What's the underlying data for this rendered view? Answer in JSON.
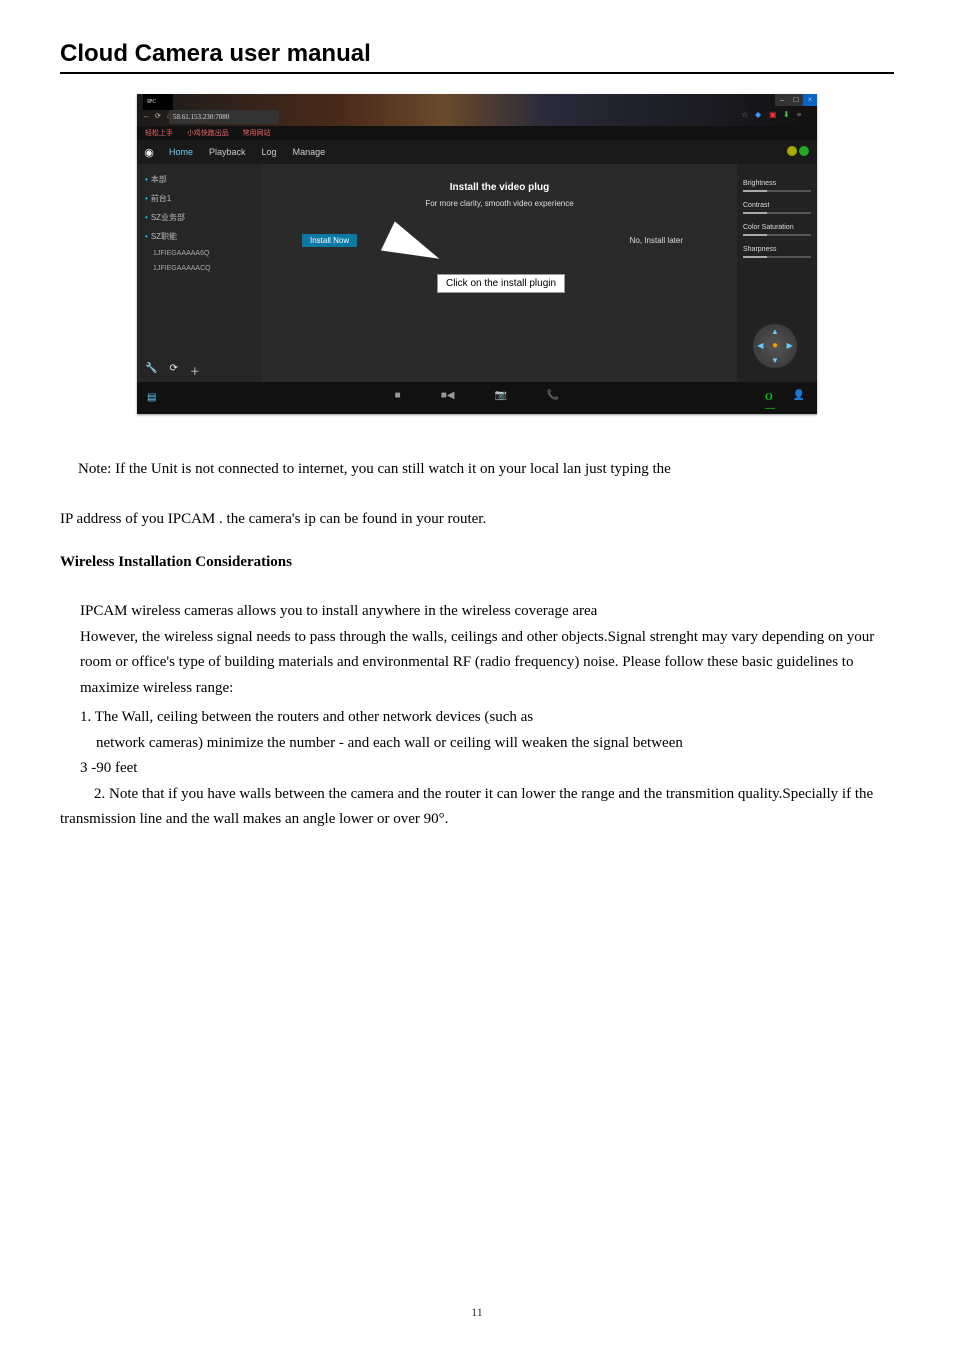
{
  "doc_title": "Cloud Camera user manual",
  "page_number": "11",
  "browser": {
    "tab_title": "IPC",
    "url": "58.61.153.230:7080",
    "bookmarks": [
      "轻松上手",
      "小鸡快跑出品",
      "常用网站"
    ]
  },
  "app": {
    "topnav": {
      "home": "Home",
      "playback": "Playback",
      "log": "Log",
      "manage": "Manage"
    },
    "sidebar": {
      "items": [
        "本部",
        "前台1",
        "SZ业务部",
        "SZ职能"
      ],
      "subitems": [
        "1JFIEGAAAAA6Q",
        "1JFIEGAAAAACQ"
      ]
    },
    "center": {
      "title": "Install the video plug",
      "subtitle": "For more clarity, smooth video experience",
      "install_btn": "Install Now",
      "later_btn": "No, Install later",
      "callout": "Click on the install plugin"
    },
    "right": {
      "brightness": "Brightness",
      "contrast": "Contrast",
      "saturation": "Color Saturation",
      "sharpness": "Sharpness"
    },
    "record_label": "O—"
  },
  "note_text": "Note: If the Unit is not connected to internet, you can still watch it on your local lan just typing the",
  "note_text2": "IP address of you IPCAM . the camera's ip can be found in your router.",
  "section_title": "Wireless Installation Considerations",
  "para1": "IPCAM wireless cameras allows you to install anywhere in the wireless coverage area",
  "para2": "However, the wireless signal needs to pass through the walls, ceilings and other objects.Signal strenght may vary depending on your room or office's type of building materials and environmental RF (radio frequency) noise. Please follow these basic guidelines to maximize wireless range:",
  "li1": "1. The Wall, ceiling between the routers and other network devices (such as",
  "li1b": "network cameras) minimize the number - and each wall or ceiling will weaken the signal between",
  "li1c": "3 -90 feet",
  "li2": "2.  Note that if you have walls between the camera and the router it can lower the range and the transmition quality.Specially if the transmission line and the wall makes an angle lower or over 90°."
}
